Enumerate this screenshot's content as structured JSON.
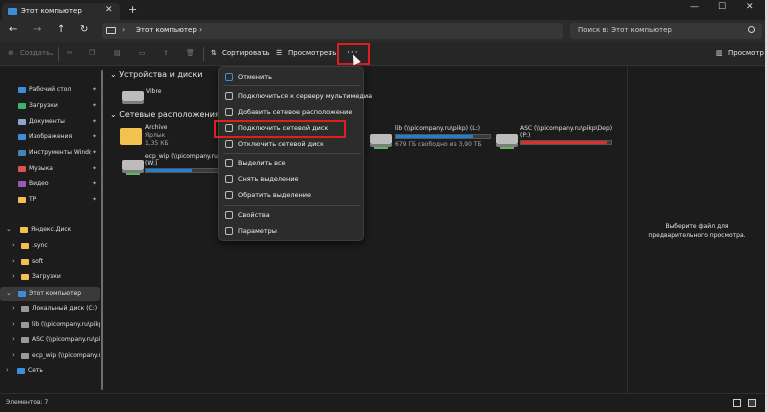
{
  "window": {
    "tab_title": "Этот компьютер",
    "icons": [
      "folder-tab-icon",
      "close-icon",
      "plus-icon",
      "minimize-icon",
      "maximize-icon",
      "close-window-icon"
    ]
  },
  "address_bar": {
    "path": "Этот компьютер",
    "search_placeholder": "Поиск в: Этот компьютер"
  },
  "toolbar": {
    "create_label": "Создать",
    "sort_label": "Сортировать",
    "view_label": "Просмотреть",
    "more_label": "···",
    "preview_label": "Просмотр"
  },
  "nav": {
    "quick_access": [
      {
        "label": "Рабочий стол",
        "color": "#3b8fd9"
      },
      {
        "label": "Загрузки",
        "color": "#3ab36b"
      },
      {
        "label": "Документы",
        "color": "#8aa6c9"
      },
      {
        "label": "Изображения",
        "color": "#3b8fd9"
      },
      {
        "label": "Инструменты Windows",
        "color": "#4a7fb8"
      },
      {
        "label": "Музыка",
        "color": "#d9534f"
      },
      {
        "label": "Видео",
        "color": "#9b59b6"
      },
      {
        "label": "TP",
        "color": "#f2c14e"
      }
    ],
    "yandex": {
      "label": "Яндекс.Диск"
    },
    "yandex_children": [
      ".sync",
      "soft",
      "Загрузки"
    ],
    "this_pc": {
      "label": "Этот компьютер"
    },
    "drives": [
      "Локальный диск (C:)",
      "lib (\\\\picompany.ru\\pikp) (L:)",
      "ASC (\\\\picompany.ru\\pikp\\Dep) (P:)",
      "ecp_wip (\\\\picompany.ru\\pikp) (W:)"
    ],
    "network": {
      "label": "Сеть"
    }
  },
  "content": {
    "devices_header": "Устройства и диски",
    "network_header": "Сетевые расположения",
    "device_items": [
      {
        "name": "Vibre"
      }
    ],
    "network_items": [
      {
        "name": "Archive",
        "sub1": "Ярлык",
        "sub2": "1,35 КБ"
      },
      {
        "name": "ecp_wip (\\\\picompany.ru\\pikp)",
        "sub1": "(W:)",
        "fill": 0.62,
        "fill_color": "#1f7fd1"
      },
      {
        "name": "lib (\\\\picompany.ru\\pikp) (L:)",
        "sub1": "679 ГБ свободно из 3,90 ТБ",
        "fill": 0.82,
        "fill_color": "#1f7fd1"
      },
      {
        "name": "ASC (\\\\picompany.ru\\pikp\\Dep)",
        "sub1": "(P:)",
        "fill": 0.95,
        "fill_color": "#d9302c"
      }
    ]
  },
  "menu": {
    "items": [
      {
        "label": "Отменить",
        "icon": "undo-icon"
      },
      {
        "label": "Подключиться к серверу мультимедиа",
        "icon": "media-server-icon"
      },
      {
        "label": "Добавить сетевое расположение",
        "icon": "network-location-icon"
      },
      {
        "label": "Подключить сетевой диск",
        "icon": "map-drive-icon"
      },
      {
        "label": "Отключить сетевой диск",
        "icon": "disconnect-drive-icon"
      },
      {
        "label": "Выделить все",
        "icon": "select-all-icon"
      },
      {
        "label": "Снять выделение",
        "icon": "select-none-icon"
      },
      {
        "label": "Обратить выделение",
        "icon": "invert-selection-icon"
      },
      {
        "label": "Свойства",
        "icon": "properties-icon"
      },
      {
        "label": "Параметры",
        "icon": "options-icon"
      }
    ]
  },
  "preview_pane": {
    "text": "Выберите файл для предварительного просмотра."
  },
  "status": {
    "items_count": "Элементов: 7"
  },
  "colors": {
    "accent": "#3b8fd9",
    "highlight": "#e01e1e",
    "background": "#1c1c1c"
  }
}
